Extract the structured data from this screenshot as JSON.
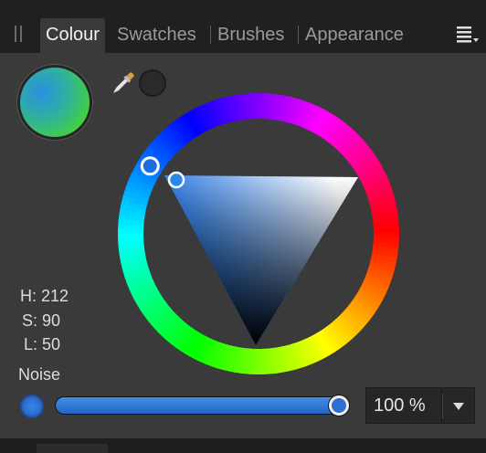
{
  "tabs": [
    {
      "label": "Colour",
      "active": true
    },
    {
      "label": "Swatches",
      "active": false
    },
    {
      "label": "Brushes",
      "active": false
    },
    {
      "label": "Appearance",
      "active": false
    }
  ],
  "colour": {
    "hue": 212,
    "saturation": 90,
    "lightness": 50
  },
  "hsl_readout": {
    "h_label": "H: 212",
    "s_label": "S: 90",
    "l_label": "L: 50"
  },
  "noise": {
    "label": "Noise",
    "value_percent": 100,
    "value_text": "100 %"
  },
  "colors": {
    "panel_bg": "#3a3a3a",
    "tabbar_bg": "#202020",
    "accent_blue": "#2f6fd0"
  },
  "icons": {
    "picker": "eyedropper-icon",
    "menu": "panel-menu-icon",
    "dropdown": "dropdown-arrow-icon"
  }
}
